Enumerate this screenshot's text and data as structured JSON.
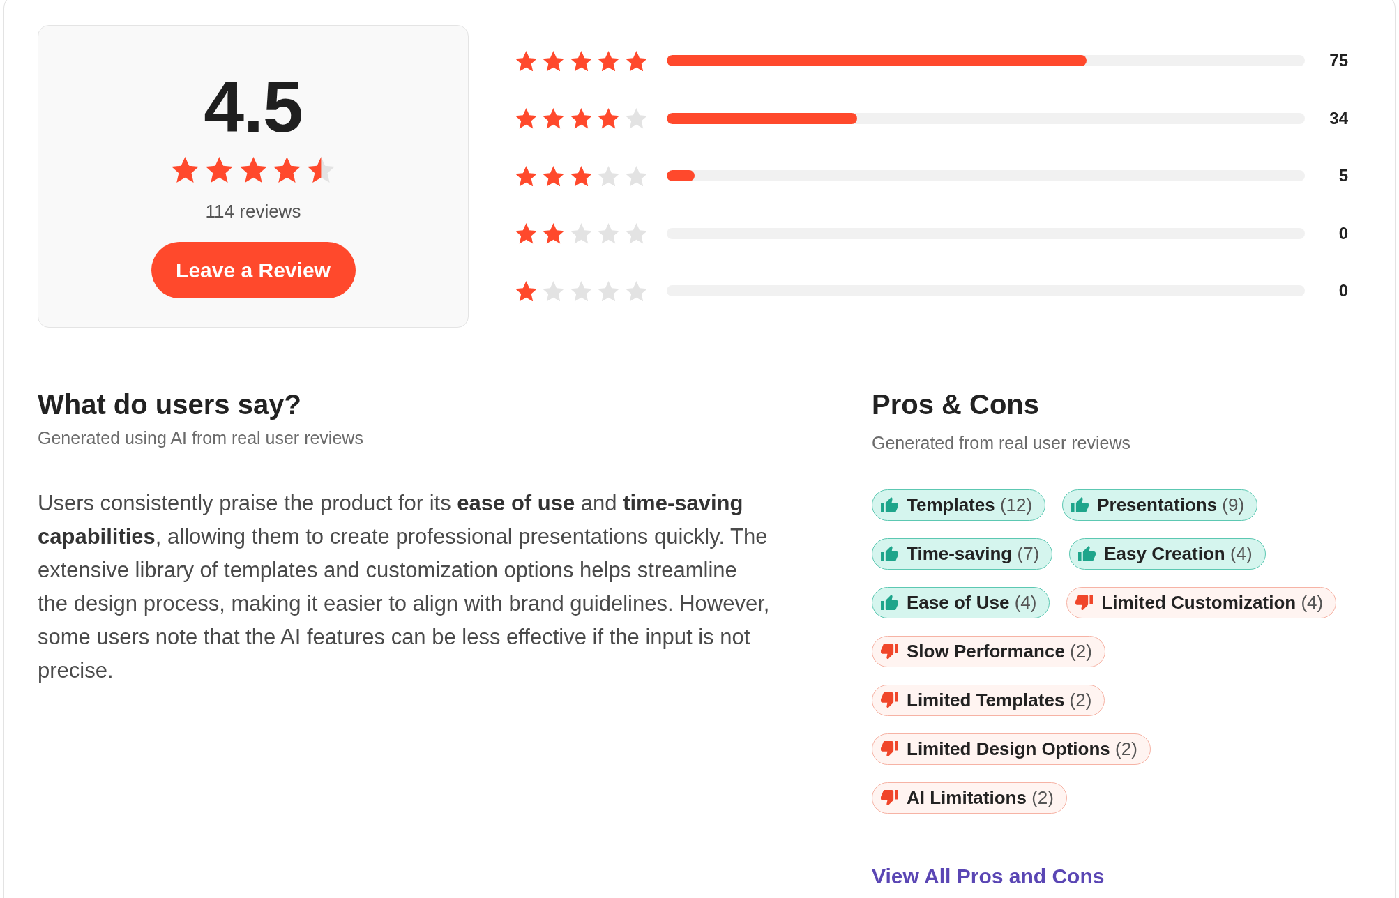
{
  "summary": {
    "score": "4.5",
    "stars": 4.5,
    "review_count": "114 reviews",
    "button": "Leave a Review"
  },
  "distribution": [
    {
      "stars": 5,
      "level": 0.658,
      "count": "75"
    },
    {
      "stars": 4,
      "level": 0.298,
      "count": "34"
    },
    {
      "stars": 3,
      "level": 0.044,
      "count": "5"
    },
    {
      "stars": 2,
      "count": "0"
    },
    {
      "stars": 1,
      "count": "0"
    }
  ],
  "users_say": {
    "title": "What do users say?",
    "subtitle": "Generated using AI from real user reviews",
    "text": "Users consistently praise the product for its **ease of use** and **time-saving capabilities**, allowing them to create professional presentations quickly. The extensive library of templates and customization options helps streamline the design process, making it easier to align with brand guidelines. However, some users note that the AI features can be less effective if the input is not precise."
  },
  "pros_cons": {
    "title": "Pros & Cons",
    "subtitle": "Generated from real user reviews",
    "chips": [
      {
        "kind": "pro",
        "label": "Templates",
        "count": "(12)"
      },
      {
        "kind": "pro",
        "label": "Presentations",
        "count": "(9)"
      },
      {
        "kind": "pro",
        "label": "Time-saving",
        "count": "(7)"
      },
      {
        "kind": "pro",
        "label": "Easy Creation",
        "count": "(4)"
      },
      {
        "kind": "pro",
        "label": "Ease of Use",
        "count": "(4)"
      },
      {
        "kind": "con",
        "label": "Limited Customization",
        "count": "(4)"
      },
      {
        "kind": "con",
        "label": "Slow Performance",
        "count": "(2)"
      },
      {
        "kind": "con",
        "label": "Limited Templates",
        "count": "(2)"
      },
      {
        "kind": "con",
        "label": "Limited Design Options",
        "count": "(2)"
      },
      {
        "kind": "con",
        "label": "AI Limitations",
        "count": "(2)"
      }
    ],
    "link": "View All Pros and Cons"
  }
}
